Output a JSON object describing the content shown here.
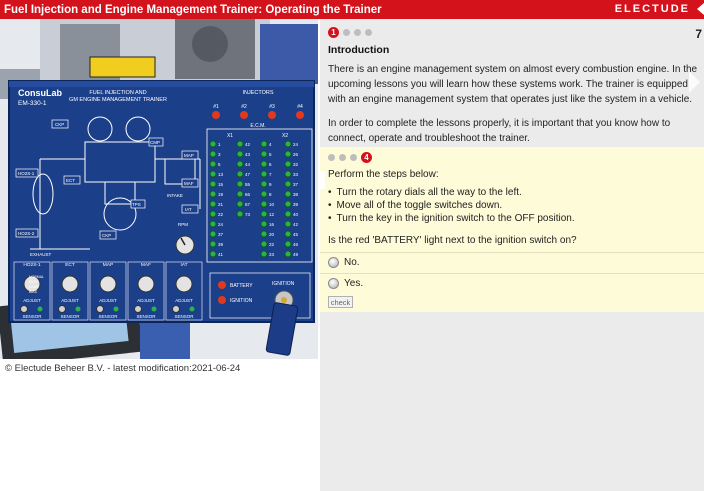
{
  "header": {
    "title": "Fuel Injection and Engine Management Trainer: Operating the Trainer",
    "brand": "ELECTUDE"
  },
  "footer": {
    "text": "© Electude Beheer B.V. - latest modification:2021-06-24"
  },
  "panel": {
    "logo": "ConsuLab",
    "model": "EM-330-1",
    "title_line1": "FUEL INJECTION AND",
    "title_line2": "GM ENGINE MANAGEMENT TRAINER",
    "injectors_label": "INJECTORS",
    "injector_labels": [
      "#1",
      "#2",
      "#3",
      "#4"
    ],
    "ecm_label": "E.C.M.",
    "x1_label": "X1",
    "x2_label": "X2",
    "pins_x1_left": [
      "1",
      "3",
      "5",
      "13",
      "15",
      "19",
      "21",
      "22",
      "24",
      "37",
      "39",
      "41"
    ],
    "pins_x1_right": [
      "42",
      "43",
      "44",
      "47",
      "55",
      "66",
      "67",
      "73"
    ],
    "pins_x2_left": [
      "4",
      "5",
      "6",
      "7",
      "9",
      "8",
      "10",
      "12",
      "16",
      "20",
      "22",
      "23"
    ],
    "pins_x2_right": [
      "24",
      "26",
      "32",
      "33",
      "37",
      "38",
      "39",
      "40",
      "42",
      "45",
      "46",
      "49"
    ],
    "pins_x2_far": [
      "49",
      "50",
      "51",
      "53",
      "54",
      "57",
      "58",
      "59",
      "65",
      "66",
      "68",
      "73"
    ],
    "labels": {
      "ckp": "CKP",
      "ect": "ECT",
      "map": "MAP",
      "iat": "IAT",
      "o2_1": "HO2S-1",
      "o2_2": "HO2S-2",
      "exhaust": "EXHAUST",
      "intake": "INTAKE",
      "rpm": "RPM",
      "battery": "BATTERY",
      "ignition": "IGNITION",
      "tps": "TPS",
      "cmp": "CMP",
      "maf": "MAF"
    },
    "sensor_groups": [
      "HO2S-1",
      "ECT",
      "MAP",
      "MAF",
      "IAT"
    ],
    "mix_labels": [
      "NORMAL",
      "RICH",
      "LEAN",
      "BIAS"
    ],
    "adjust_label": "ADJUST",
    "sensor_label": "SENSOR"
  },
  "content": {
    "page_number": "7",
    "step_top": "1",
    "step_question": "4",
    "intro_heading": "Introduction",
    "intro_paragraph": "There is an engine management system on almost every combustion engine. In the upcoming lessons you will learn how these systems work. The trainer is equipped with an engine management system that operates just like the system in a vehicle.",
    "intro_paragraph2": "In order to complete the lessons properly, it is important that you know how to connect, operate and troubleshoot the trainer.",
    "question": {
      "lead": "Perform the steps below:",
      "steps": [
        "Turn the rotary dials all the way to the left.",
        "Move all of the toggle switches down.",
        "Turn the key in the ignition switch to the OFF position."
      ],
      "ask": "Is the red 'BATTERY' light next to the ignition switch on?",
      "options": [
        "No.",
        "Yes."
      ],
      "check_label": "check"
    }
  },
  "colors": {
    "accent": "#d4121b",
    "panel_blue": "#1c3f8a",
    "question_bg": "#fdfbd8",
    "content_bg": "#ebebeb"
  }
}
